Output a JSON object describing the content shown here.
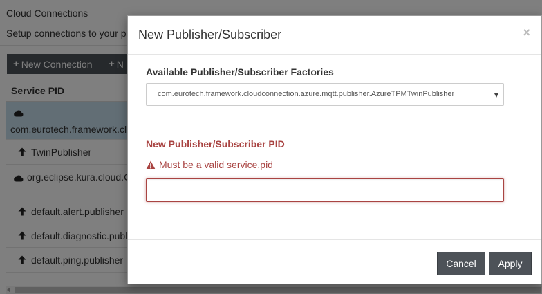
{
  "page": {
    "title": "Cloud Connections",
    "description": "Setup connections to your pl",
    "toolbar": {
      "new_connection_label": "New Connection",
      "second_button_label": "N"
    },
    "table": {
      "header": "Service PID",
      "rows": [
        {
          "icon": "cloud-icon",
          "label": "com.eurotech.framework.cl"
        },
        {
          "icon": "arrow-up-icon",
          "label": "TwinPublisher"
        },
        {
          "icon": "cloud-icon",
          "label": "org.eclipse.kura.cloud.C"
        },
        {
          "icon": "arrow-up-icon",
          "label": "default.alert.publisher"
        },
        {
          "icon": "arrow-up-icon",
          "label": "default.diagnostic.publi"
        },
        {
          "icon": "arrow-up-icon",
          "label": "default.ping.publisher"
        }
      ]
    }
  },
  "modal": {
    "title": "New Publisher/Subscriber",
    "close_glyph": "×",
    "factories_label": "Available Publisher/Subscriber Factories",
    "factories_selected": "com.eurotech.framework.cloudconnection.azure.mqtt.publisher.AzureTPMTwinPublisher",
    "pid_label": "New Publisher/Subscriber PID",
    "pid_error": "Must be a valid service.pid",
    "pid_value": "",
    "cancel_label": "Cancel",
    "apply_label": "Apply"
  },
  "colors": {
    "error": "#a94442",
    "button": "#4d5258",
    "selected_row": "#c5dcea"
  }
}
